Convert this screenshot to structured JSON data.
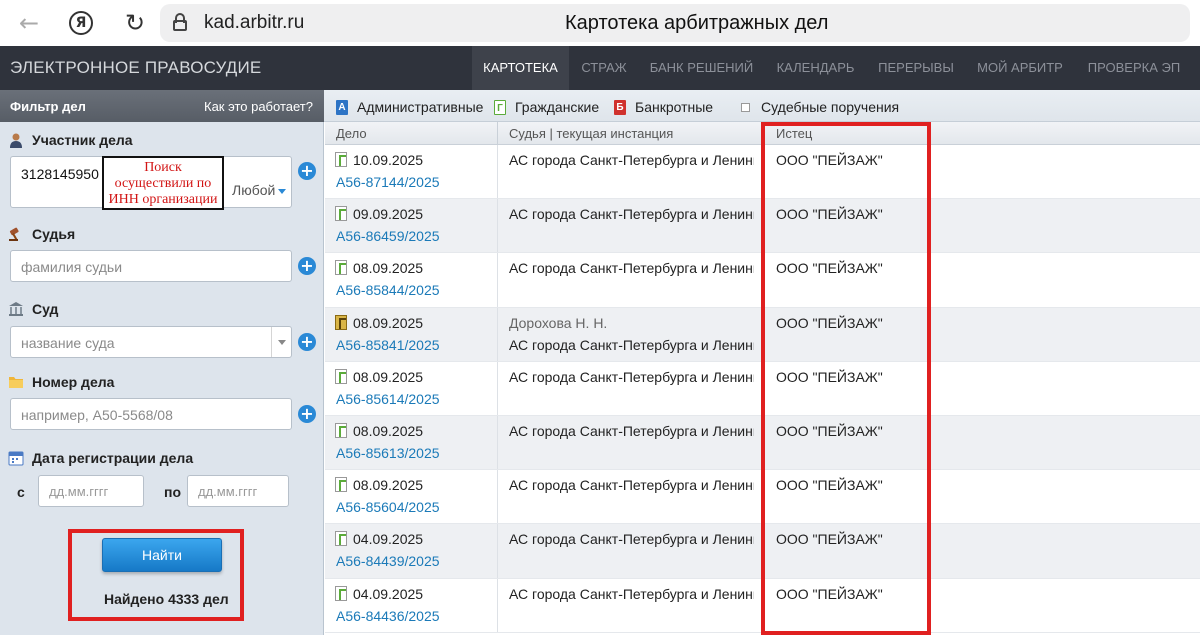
{
  "browser": {
    "url": "kad.arbitr.ru",
    "tab_title": "Картотека арбитражных дел",
    "ya_glyph": "Я",
    "back_glyph": "←",
    "reload_glyph": "↻"
  },
  "header": {
    "logo": "ЭЛЕКТРОННОЕ ПРАВОСУДИЕ",
    "menu": [
      {
        "label": "КАРТОТЕКА",
        "active": true
      },
      {
        "label": "СТРАЖ"
      },
      {
        "label": "БАНК РЕШЕНИЙ"
      },
      {
        "label": "КАЛЕНДАРЬ"
      },
      {
        "label": "ПЕРЕРЫВЫ"
      },
      {
        "label": "МОЙ АРБИТР"
      },
      {
        "label": "ПРОВЕРКА ЭП"
      }
    ]
  },
  "filter_bar": {
    "title": "Фильтр дел",
    "how_it_works": "Как это работает?",
    "categories": [
      {
        "label": "Административные",
        "icon_letter": "А"
      },
      {
        "label": "Гражданские",
        "icon_letter": "Г"
      },
      {
        "label": "Банкротные",
        "icon_letter": "Б"
      }
    ],
    "court_orders": "Судебные поручения"
  },
  "sidebar": {
    "participant": {
      "label": "Участник дела",
      "value": "3128145950",
      "any": "Любой"
    },
    "annotation": "Поиск осуществили по ИНН организации",
    "judge": {
      "label": "Судья",
      "placeholder": "фамилия судьи"
    },
    "court": {
      "label": "Суд",
      "placeholder": "название суда"
    },
    "case_number": {
      "label": "Номер дела",
      "placeholder": "например, А50-5568/08"
    },
    "reg_date": {
      "label": "Дата регистрации дела",
      "from_label": "с",
      "to_label": "по",
      "from_placeholder": "дд.мм.гггг",
      "to_placeholder": "дд.мм.гггг"
    },
    "find_button": "Найти",
    "found_text": "Найдено 4333 дел",
    "plus_glyph": "+"
  },
  "table": {
    "headers": {
      "case": "Дело",
      "judge": "Судья | текущая инстанция",
      "plaintiff": "Истец"
    },
    "rows": [
      {
        "date": "10.09.2025",
        "number": "А56-87144/2025",
        "judge": "",
        "court": "АС города Санкт-Петербурга и Ленинградской области",
        "plaintiff": "ООО \"ПЕЙЗАЖ\""
      },
      {
        "date": "09.09.2025",
        "number": "А56-86459/2025",
        "judge": "",
        "court": "АС города Санкт-Петербурга и Ленинградской области",
        "plaintiff": "ООО \"ПЕЙЗАЖ\""
      },
      {
        "date": "08.09.2025",
        "number": "А56-85844/2025",
        "judge": "",
        "court": "АС города Санкт-Петербурга и Ленинградской области",
        "plaintiff": "ООО \"ПЕЙЗАЖ\""
      },
      {
        "date": "08.09.2025",
        "number": "А56-85841/2025",
        "judge": "Дорохова Н. Н.",
        "court": "АС города Санкт-Петербурга и Ленинградской области",
        "plaintiff": "ООО \"ПЕЙЗАЖ\"",
        "gold": true
      },
      {
        "date": "08.09.2025",
        "number": "А56-85614/2025",
        "judge": "",
        "court": "АС города Санкт-Петербурга и Ленинградской области",
        "plaintiff": "ООО \"ПЕЙЗАЖ\""
      },
      {
        "date": "08.09.2025",
        "number": "А56-85613/2025",
        "judge": "",
        "court": "АС города Санкт-Петербурга и Ленинградской области",
        "plaintiff": "ООО \"ПЕЙЗАЖ\""
      },
      {
        "date": "08.09.2025",
        "number": "А56-85604/2025",
        "judge": "",
        "court": "АС города Санкт-Петербурга и Ленинградской области",
        "plaintiff": "ООО \"ПЕЙЗАЖ\""
      },
      {
        "date": "04.09.2025",
        "number": "А56-84439/2025",
        "judge": "",
        "court": "АС города Санкт-Петербурга и Ленинградской области",
        "plaintiff": "ООО \"ПЕЙЗАЖ\""
      },
      {
        "date": "04.09.2025",
        "number": "А56-84436/2025",
        "judge": "",
        "court": "АС города Санкт-Петербурга и Ленинградской области",
        "plaintiff": "ООО \"ПЕЙЗАЖ\""
      }
    ]
  },
  "colors": {
    "header_bg": "#2f333c",
    "link": "#1b7ab8",
    "highlight_frame": "#e02020",
    "button": "#1e8ad9"
  }
}
